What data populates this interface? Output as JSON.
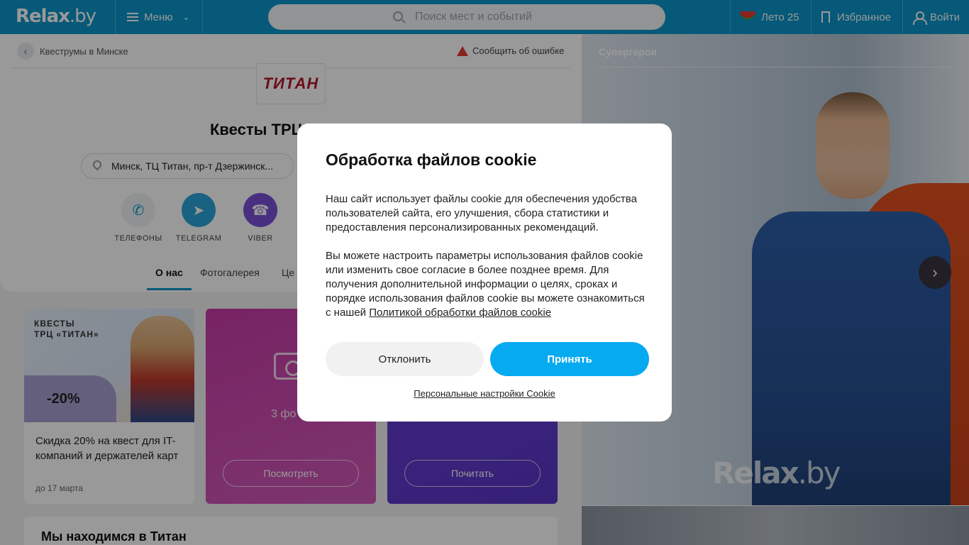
{
  "header": {
    "logo": "Relax",
    "logo_suffix": ".by",
    "menu_label": "Меню",
    "search_placeholder": "Поиск мест и событий",
    "summer_label": "Лето 25",
    "favorites_label": "Избранное",
    "login_label": "Войти"
  },
  "breadcrumb": {
    "back_label": "Квеструмы в Минске",
    "report_label": "Сообщить об ошибке"
  },
  "venue": {
    "brand_logo_text": "ТИТАН",
    "title": "Квесты ТРЦ «Т",
    "address": "Минск, ТЦ Титан, пр-т Дзержинск...",
    "contacts": [
      {
        "label": "ТЕЛЕФОНЫ",
        "color": "#f0f2f4",
        "icon": "phone-icon"
      },
      {
        "label": "TELEGRAM",
        "color": "#2aa3d9",
        "icon": "telegram-icon"
      },
      {
        "label": "VIBER",
        "color": "#7b4fd6",
        "icon": "viber-icon"
      }
    ],
    "tabs": [
      "О нас",
      "Фотогалерея",
      "Це"
    ]
  },
  "promos": {
    "promo1": {
      "brand_line1": "КВЕСТЫ",
      "brand_line2": "ТРЦ «ТИТАН»",
      "discount": "-20%",
      "title": "Скидка 20% на квест для IT-компаний и держателей карт",
      "date": "до 17 марта"
    },
    "promo2": {
      "count_text": "3 фо",
      "button": "Посмотреть"
    },
    "promo3": {
      "button": "Почитать"
    }
  },
  "location": {
    "title": "Мы находимся в Титан"
  },
  "gallery": {
    "caption": "Супергерои",
    "watermark": "Relax",
    "watermark_suffix": ".by"
  },
  "cookie_modal": {
    "title": "Обработка файлов cookie",
    "paragraph1": "Наш сайт использует файлы cookie для обеспечения удобства пользователей сайта, его улучшения, сбора статистики и предоставления персонализированных рекомендаций.",
    "paragraph2": "Вы можете настроить параметры использования файлов cookie или изменить свое согласие в более позднее время. Для получения дополнительной информации о целях, сроках и порядке использования файлов cookie вы можете ознакомиться с нашей",
    "policy_link": "Политикой обработки файлов cookie",
    "decline": "Отклонить",
    "accept": "Принять",
    "settings_link": "Персональные настройки Cookie"
  }
}
